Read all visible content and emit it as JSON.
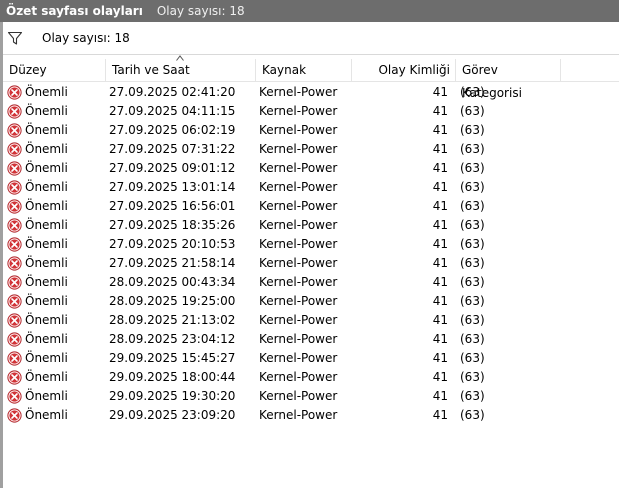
{
  "titlebar": {
    "title": "Özet sayfası olayları",
    "count": "Olay sayısı: 18"
  },
  "filterbar": {
    "icon": "filter-icon",
    "text": "Olay sayısı: 18"
  },
  "columns": [
    {
      "key": "level",
      "label": "Düzey"
    },
    {
      "key": "date",
      "label": "Tarih ve Saat"
    },
    {
      "key": "source",
      "label": "Kaynak"
    },
    {
      "key": "id",
      "label": "Olay Kimliği"
    },
    {
      "key": "cat",
      "label": "Görev Kategorisi"
    }
  ],
  "rows": [
    {
      "level": "Önemli",
      "date": "27.09.2025 02:41:20",
      "source": "Kernel-Power",
      "id": "41",
      "cat": "(63)"
    },
    {
      "level": "Önemli",
      "date": "27.09.2025 04:11:15",
      "source": "Kernel-Power",
      "id": "41",
      "cat": "(63)"
    },
    {
      "level": "Önemli",
      "date": "27.09.2025 06:02:19",
      "source": "Kernel-Power",
      "id": "41",
      "cat": "(63)"
    },
    {
      "level": "Önemli",
      "date": "27.09.2025 07:31:22",
      "source": "Kernel-Power",
      "id": "41",
      "cat": "(63)"
    },
    {
      "level": "Önemli",
      "date": "27.09.2025 09:01:12",
      "source": "Kernel-Power",
      "id": "41",
      "cat": "(63)"
    },
    {
      "level": "Önemli",
      "date": "27.09.2025 13:01:14",
      "source": "Kernel-Power",
      "id": "41",
      "cat": "(63)"
    },
    {
      "level": "Önemli",
      "date": "27.09.2025 16:56:01",
      "source": "Kernel-Power",
      "id": "41",
      "cat": "(63)"
    },
    {
      "level": "Önemli",
      "date": "27.09.2025 18:35:26",
      "source": "Kernel-Power",
      "id": "41",
      "cat": "(63)"
    },
    {
      "level": "Önemli",
      "date": "27.09.2025 20:10:53",
      "source": "Kernel-Power",
      "id": "41",
      "cat": "(63)"
    },
    {
      "level": "Önemli",
      "date": "27.09.2025 21:58:14",
      "source": "Kernel-Power",
      "id": "41",
      "cat": "(63)"
    },
    {
      "level": "Önemli",
      "date": "28.09.2025 00:43:34",
      "source": "Kernel-Power",
      "id": "41",
      "cat": "(63)"
    },
    {
      "level": "Önemli",
      "date": "28.09.2025 19:25:00",
      "source": "Kernel-Power",
      "id": "41",
      "cat": "(63)"
    },
    {
      "level": "Önemli",
      "date": "28.09.2025 21:13:02",
      "source": "Kernel-Power",
      "id": "41",
      "cat": "(63)"
    },
    {
      "level": "Önemli",
      "date": "28.09.2025 23:04:12",
      "source": "Kernel-Power",
      "id": "41",
      "cat": "(63)"
    },
    {
      "level": "Önemli",
      "date": "29.09.2025 15:45:27",
      "source": "Kernel-Power",
      "id": "41",
      "cat": "(63)"
    },
    {
      "level": "Önemli",
      "date": "29.09.2025 18:00:44",
      "source": "Kernel-Power",
      "id": "41",
      "cat": "(63)"
    },
    {
      "level": "Önemli",
      "date": "29.09.2025 19:30:20",
      "source": "Kernel-Power",
      "id": "41",
      "cat": "(63)"
    },
    {
      "level": "Önemli",
      "date": "29.09.2025 23:09:20",
      "source": "Kernel-Power",
      "id": "41",
      "cat": "(63)"
    }
  ],
  "row_icon": "error-icon",
  "colors": {
    "titlebar": "#6d6d6d",
    "error": "#d13438"
  }
}
